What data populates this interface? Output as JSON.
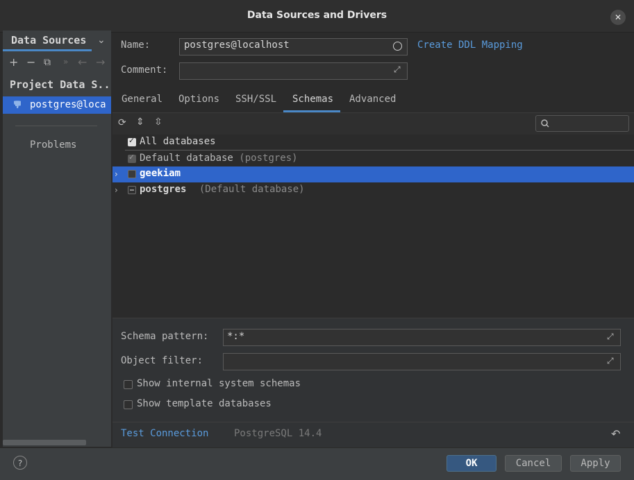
{
  "window": {
    "title": "Data Sources and Drivers"
  },
  "sidebar": {
    "tab_label": "Data Sources",
    "section_title": "Project Data S..",
    "items": [
      {
        "label": "postgres@loca"
      }
    ],
    "problems_label": "Problems"
  },
  "form": {
    "name_label": "Name:",
    "name_value": "postgres@localhost",
    "ddl_link": "Create DDL Mapping",
    "comment_label": "Comment:",
    "comment_value": ""
  },
  "tabs": [
    {
      "label": "General"
    },
    {
      "label": "Options"
    },
    {
      "label": "SSH/SSL"
    },
    {
      "label": "Schemas"
    },
    {
      "label": "Advanced"
    }
  ],
  "active_tab": "Schemas",
  "tree": {
    "all_databases": "All databases",
    "default_database": "Default database",
    "default_database_note": "(postgres)",
    "rows": [
      {
        "name": "geekiam",
        "note": ""
      },
      {
        "name": "postgres",
        "note": "(Default database)"
      }
    ]
  },
  "options": {
    "schema_pattern_label": "Schema pattern:",
    "schema_pattern_value": "*:*",
    "object_filter_label": "Object filter:",
    "object_filter_value": "",
    "show_internal_label": "Show internal system schemas",
    "show_template_label": "Show template databases"
  },
  "status": {
    "test_connection": "Test Connection",
    "version": "PostgreSQL 14.4"
  },
  "footer": {
    "help": "?",
    "ok": "OK",
    "cancel": "Cancel",
    "apply": "Apply"
  },
  "colors": {
    "accent": "#4a88c7",
    "selection": "#2f65ca",
    "link": "#5a9bdc"
  }
}
